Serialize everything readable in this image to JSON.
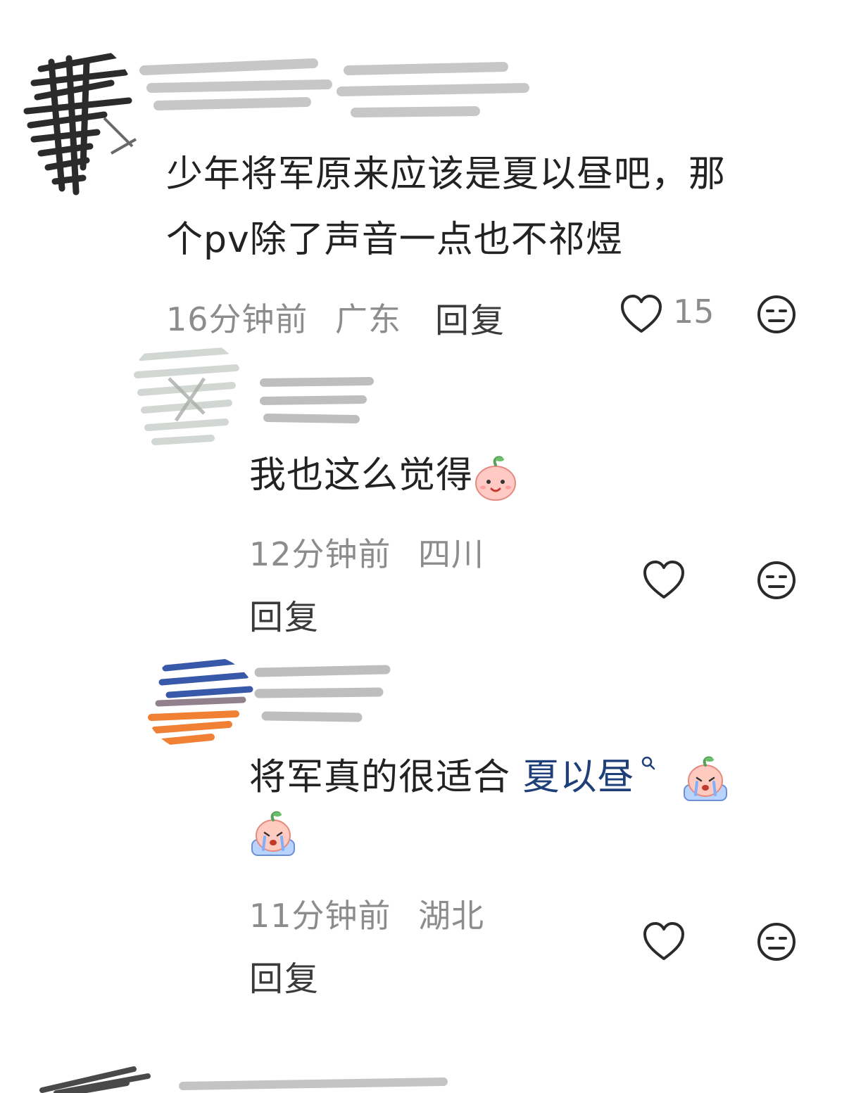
{
  "comments": [
    {
      "text_line1": "少年将军原来应该是夏以昼吧，那",
      "text_line2": "个pv除了声音一点也不祁煜",
      "time": "16分钟前",
      "location": "广东",
      "reply_label": "回复",
      "like_count": "15"
    },
    {
      "text": "我也这么觉得",
      "emoji_icon": "peach-smile-icon",
      "time": "12分钟前",
      "location": "四川",
      "reply_label": "回复"
    },
    {
      "text": "将军真的很适合 ",
      "mention": "夏以昼",
      "mention_icon": "search-icon",
      "emoji_icon": "peach-crying-icon",
      "time": "11分钟前",
      "location": "湖北",
      "reply_label": "回复"
    }
  ],
  "colors": {
    "meta": "#8c8c8c",
    "mention": "#1f3f78",
    "text": "#222222"
  }
}
